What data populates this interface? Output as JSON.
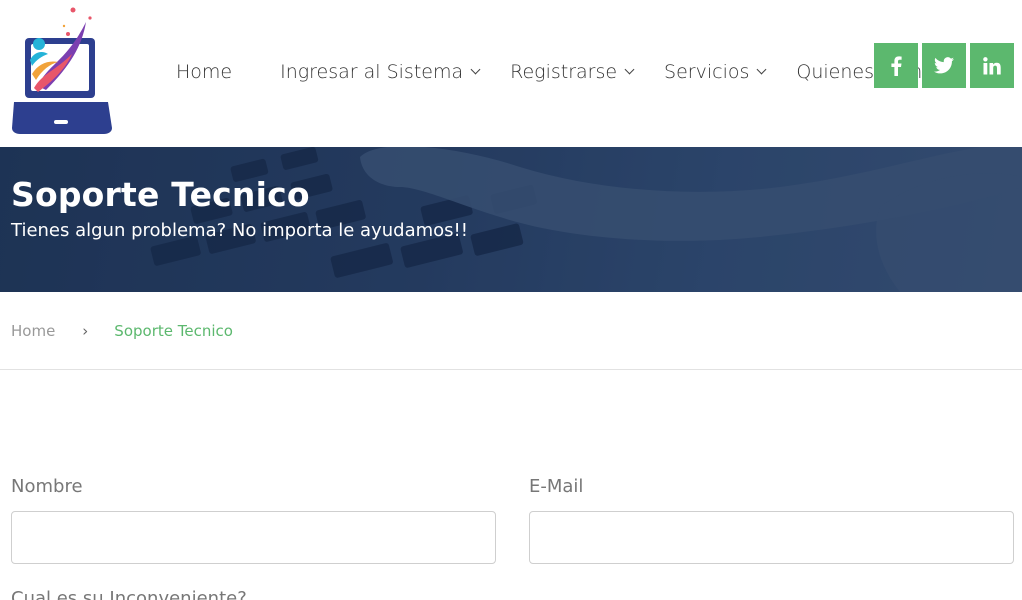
{
  "nav": {
    "items": [
      {
        "label": "Home",
        "dropdown": false
      },
      {
        "label": "Ingresar al Sistema",
        "dropdown": true
      },
      {
        "label": "Registrarse",
        "dropdown": true
      },
      {
        "label": "Servicios",
        "dropdown": true
      },
      {
        "label": "Quienes Somos",
        "dropdown": false
      }
    ]
  },
  "social": {
    "color": "#5cb86e",
    "buttons": [
      {
        "icon": "facebook-icon"
      },
      {
        "icon": "twitter-icon"
      },
      {
        "icon": "linkedin-icon"
      }
    ]
  },
  "banner": {
    "title": "Soporte Tecnico",
    "subtitle": "Tienes algun problema? No importa le ayudamos!!"
  },
  "breadcrumb": {
    "home": "Home",
    "separator": "›",
    "current": "Soporte Tecnico"
  },
  "form": {
    "nombre_label": "Nombre",
    "nombre_value": "",
    "email_label": "E-Mail",
    "email_value": "",
    "issue_label": "Cual es su Inconveniente?"
  },
  "colors": {
    "accent": "#5cb86e",
    "banner": "#253c60"
  }
}
